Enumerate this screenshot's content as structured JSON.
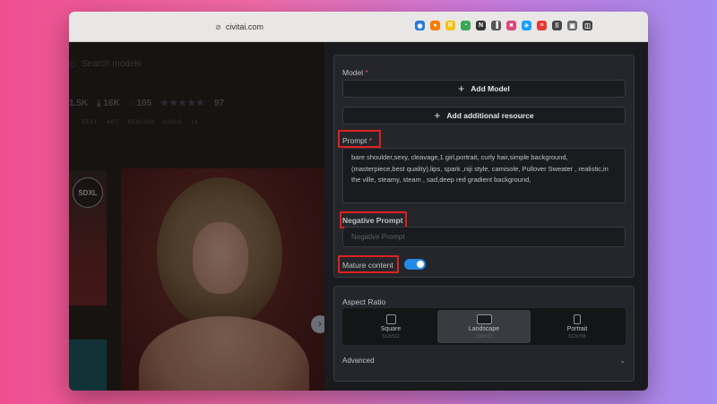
{
  "browser": {
    "url": "civitai.com",
    "extensions": [
      {
        "name": "color-wheel-icon",
        "color": "#2a7bd6",
        "glyph": "◉"
      },
      {
        "name": "orange-circle-icon",
        "color": "#f57c00",
        "glyph": "●"
      },
      {
        "name": "yellow-r-icon",
        "color": "#f4c20d",
        "glyph": "R"
      },
      {
        "name": "compass-icon",
        "color": "#3aa757",
        "glyph": "◔"
      },
      {
        "name": "n-box-icon",
        "color": "#333333",
        "glyph": "N"
      },
      {
        "name": "reader-icon",
        "color": "#555555",
        "glyph": "▐"
      },
      {
        "name": "pink-box-icon",
        "color": "#e0457b",
        "glyph": "■"
      },
      {
        "name": "bird-icon",
        "color": "#1a9fff",
        "glyph": "✈"
      },
      {
        "name": "red-box-icon",
        "color": "#e53935",
        "glyph": "≡"
      },
      {
        "name": "grid-icon",
        "color": "#444444",
        "glyph": "⠿"
      },
      {
        "name": "screenshot-icon",
        "color": "#666666",
        "glyph": "▣"
      },
      {
        "name": "sidebar-icon",
        "color": "#444444",
        "glyph": "◫"
      }
    ]
  },
  "left": {
    "search_placeholder": "Search models",
    "stats": {
      "downloads": "1.5K",
      "likes": "16K",
      "comments": "105",
      "rating": "97"
    },
    "tags": [
      "SEXY",
      "ART",
      "REALISM",
      "GIRLS",
      "+3"
    ],
    "badge": "SDXL"
  },
  "form": {
    "model": {
      "label": "Model",
      "required": "*",
      "add_model": "Add Model",
      "add_resource": "Add additional resource"
    },
    "prompt": {
      "label": "Prompt",
      "required": "*",
      "value": "bare shoulder,sexy, cleavage,1 girl,portrait, curly hair,simple background,(masterpiece,best quality),lips, spark ,niji style, camisole, Pullover Sweater , realistic,in the ville, steamy, steam , sad,deep red gradient background,"
    },
    "negative": {
      "label": "Negative Prompt",
      "placeholder": "Negative Prompt"
    },
    "mature": {
      "label": "Mature content",
      "enabled": true
    },
    "aspect": {
      "label": "Aspect Ratio",
      "options": [
        {
          "label": "Square",
          "size": "512x512"
        },
        {
          "label": "Landscape",
          "size": "768x512"
        },
        {
          "label": "Portrait",
          "size": "512x768"
        }
      ],
      "selected": "Landscape"
    },
    "advanced": {
      "label": "Advanced"
    }
  },
  "colors": {
    "accent": "#228be6",
    "highlight_box": "#e02020",
    "required": "#fa5252"
  }
}
